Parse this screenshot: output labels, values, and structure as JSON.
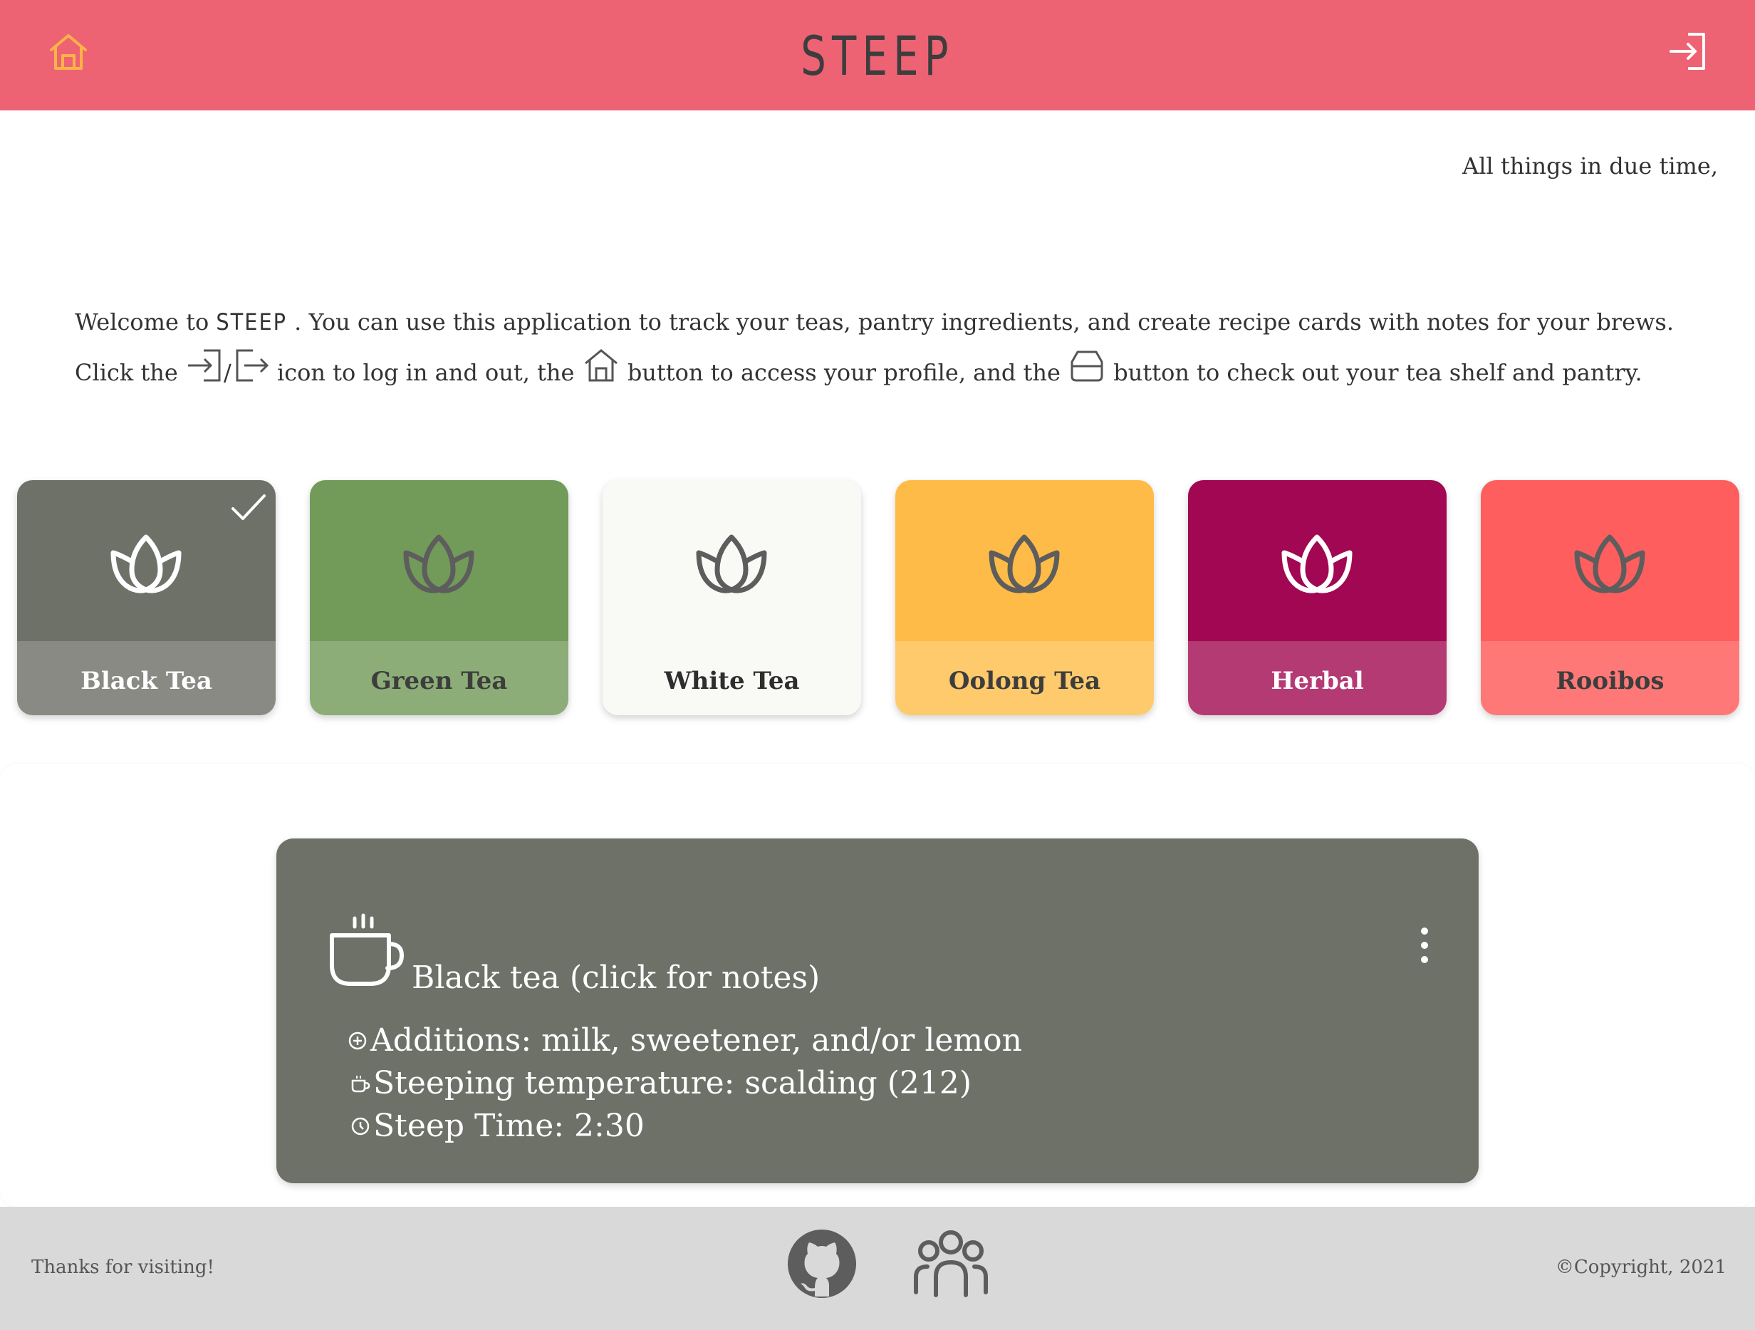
{
  "header": {
    "title": "STEEP",
    "home_icon": "home-icon",
    "login_icon": "login-icon",
    "colors": {
      "background": "#ed6373",
      "home_icon": "#ffb347",
      "title": "#3d3d3d"
    }
  },
  "quote": "All things in due time,",
  "intro": {
    "line1_prefix": "Welcome to ",
    "brand": "STEEP",
    "line1_suffix": " . You can use this application to track your teas, pantry ingredients, and create recipe cards with notes for your brews.",
    "line2_click": "Click the ",
    "slash": "/",
    "line2_login": " icon to log in and out, the ",
    "line2_profile": " button to access your profile, and the ",
    "line2_shelf": " button to check out your tea shelf and pantry."
  },
  "tea_types": [
    {
      "label": "Black Tea",
      "selected": true,
      "top_color": "#6e7168",
      "bottom_color": "#888a83",
      "text_color": "#ffffff",
      "icon_color": "#ffffff"
    },
    {
      "label": "Green Tea",
      "selected": false,
      "top_color": "#729a59",
      "bottom_color": "#8cad77",
      "text_color": "#3d3d3d",
      "icon_color": "#5d5d5d"
    },
    {
      "label": "White Tea",
      "selected": false,
      "top_color": "#f9f9f5",
      "bottom_color": "#f9f9f5",
      "text_color": "#2e2e2e",
      "icon_color": "#5d5d5d"
    },
    {
      "label": "Oolong Tea",
      "selected": false,
      "top_color": "#ffbb47",
      "bottom_color": "#ffca6c",
      "text_color": "#3d3d3d",
      "icon_color": "#5d5d5d"
    },
    {
      "label": "Herbal",
      "selected": false,
      "top_color": "#a10752",
      "bottom_color": "#b43a73",
      "text_color": "#ffffff",
      "icon_color": "#ffffff"
    },
    {
      "label": "Rooibos",
      "selected": false,
      "top_color": "#fe5e5e",
      "bottom_color": "#ff7878",
      "text_color": "#3d3d3d",
      "icon_color": "#5d5d5d"
    }
  ],
  "recipe_card": {
    "title": "Black tea (click for notes)",
    "icon": "tea-cup-icon",
    "menu_icon": "kebab-menu-icon",
    "rows": [
      {
        "icon": "plus-circle-icon",
        "text": "Additions: milk, sweetener, and/or lemon"
      },
      {
        "icon": "small-cup-icon",
        "text": "Steeping temperature: scalding (212)"
      },
      {
        "icon": "clock-icon",
        "text": "Steep Time: 2:30"
      }
    ],
    "color": "#6e7168"
  },
  "footer": {
    "thanks": "Thanks for visiting!",
    "copyright": "©Copyright, 2021",
    "github_icon": "github-icon",
    "team_icon": "team-icon"
  }
}
